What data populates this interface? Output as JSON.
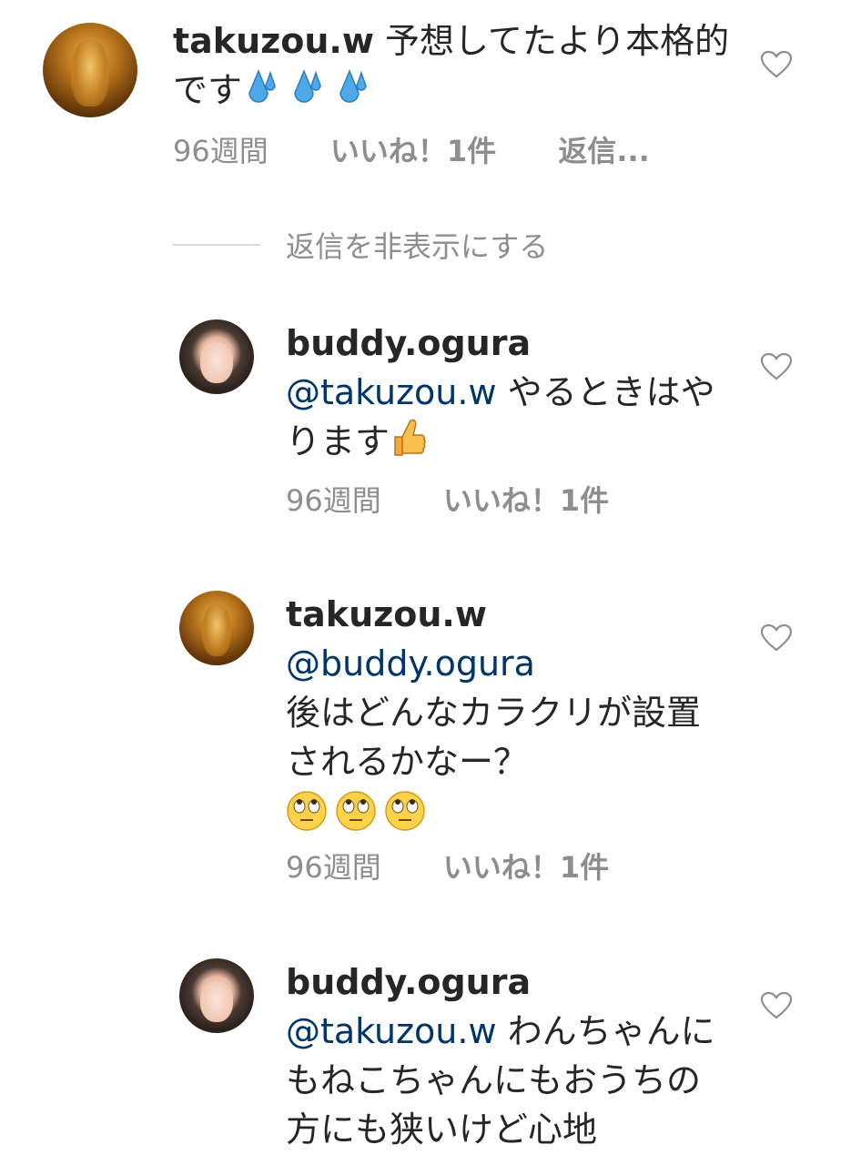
{
  "comments": [
    {
      "username": "takuzou.w",
      "text": "予想してたより本格的です",
      "emoji": "sweat-droplets",
      "time": "96週間",
      "likes": "いいね！1件",
      "reply": "返信..."
    },
    {
      "username": "buddy.ogura",
      "mention": "@takuzou.w",
      "text": "やるときはやります",
      "emoji": "thumbs-up",
      "time": "96週間",
      "likes": "いいね！1件"
    },
    {
      "username": "takuzou.w",
      "mention": "@buddy.ogura",
      "text": "後はどんなカラクリが設置されるかなー？",
      "emoji": "face-with-rolling-eyes",
      "time": "96週間",
      "likes": "いいね！1件"
    },
    {
      "username": "buddy.ogura",
      "mention": "@takuzou.w",
      "text": "わんちゃんにもねこちゃんにもおうちの方にも狭いけど心地"
    }
  ],
  "hide_replies": "返信を非表示にする",
  "colors": {
    "text": "#262626",
    "meta": "#8e8e8e",
    "mention": "#003569",
    "divider": "#dbdbdb"
  }
}
